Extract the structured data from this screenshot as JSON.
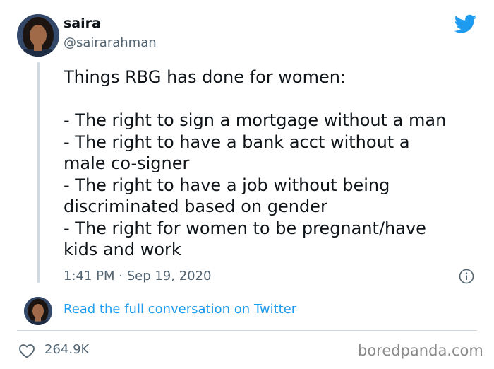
{
  "tweet": {
    "author": {
      "display_name": "saira",
      "handle": "@sairarahman"
    },
    "text": {
      "intro": "Things RBG has done for women:",
      "items": [
        "- The right to sign a mortgage without a man",
        "- The right to have a bank acct without a",
        "male co-signer",
        "- The right to have a job without being",
        "discriminated based on gender",
        "- The right for women to be pregnant/have",
        "kids and work"
      ]
    },
    "timestamp": "1:41 PM · Sep 19, 2020",
    "read_conversation_label": "Read the full conversation on Twitter",
    "like_count": "264.9K"
  },
  "watermark": "boredpanda.com",
  "icons": {
    "brand": "twitter-bird-icon",
    "info": "info-icon",
    "like": "heart-icon"
  },
  "colors": {
    "twitter_blue": "#1d9bf0",
    "secondary_text": "#536471",
    "divider": "#cfd9de"
  }
}
